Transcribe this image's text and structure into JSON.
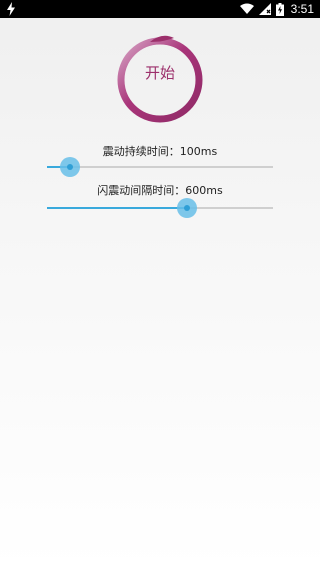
{
  "status_bar": {
    "time": "3:51",
    "icons": [
      "bolt-icon",
      "wifi-icon",
      "signal-icon",
      "battery-charging-icon"
    ]
  },
  "start_button": {
    "label": "开始",
    "accent": "#9c2f6b"
  },
  "vibration_duration": {
    "label": "震动持续时间：100ms",
    "value_fraction": 0.1
  },
  "flash_interval": {
    "label": "闪震动间隔时间：600ms",
    "value_fraction": 0.62
  },
  "colors": {
    "slider_accent": "#39a9dc",
    "ring_start": "#9c2f6b",
    "ring_end": "#d9a7c7"
  }
}
